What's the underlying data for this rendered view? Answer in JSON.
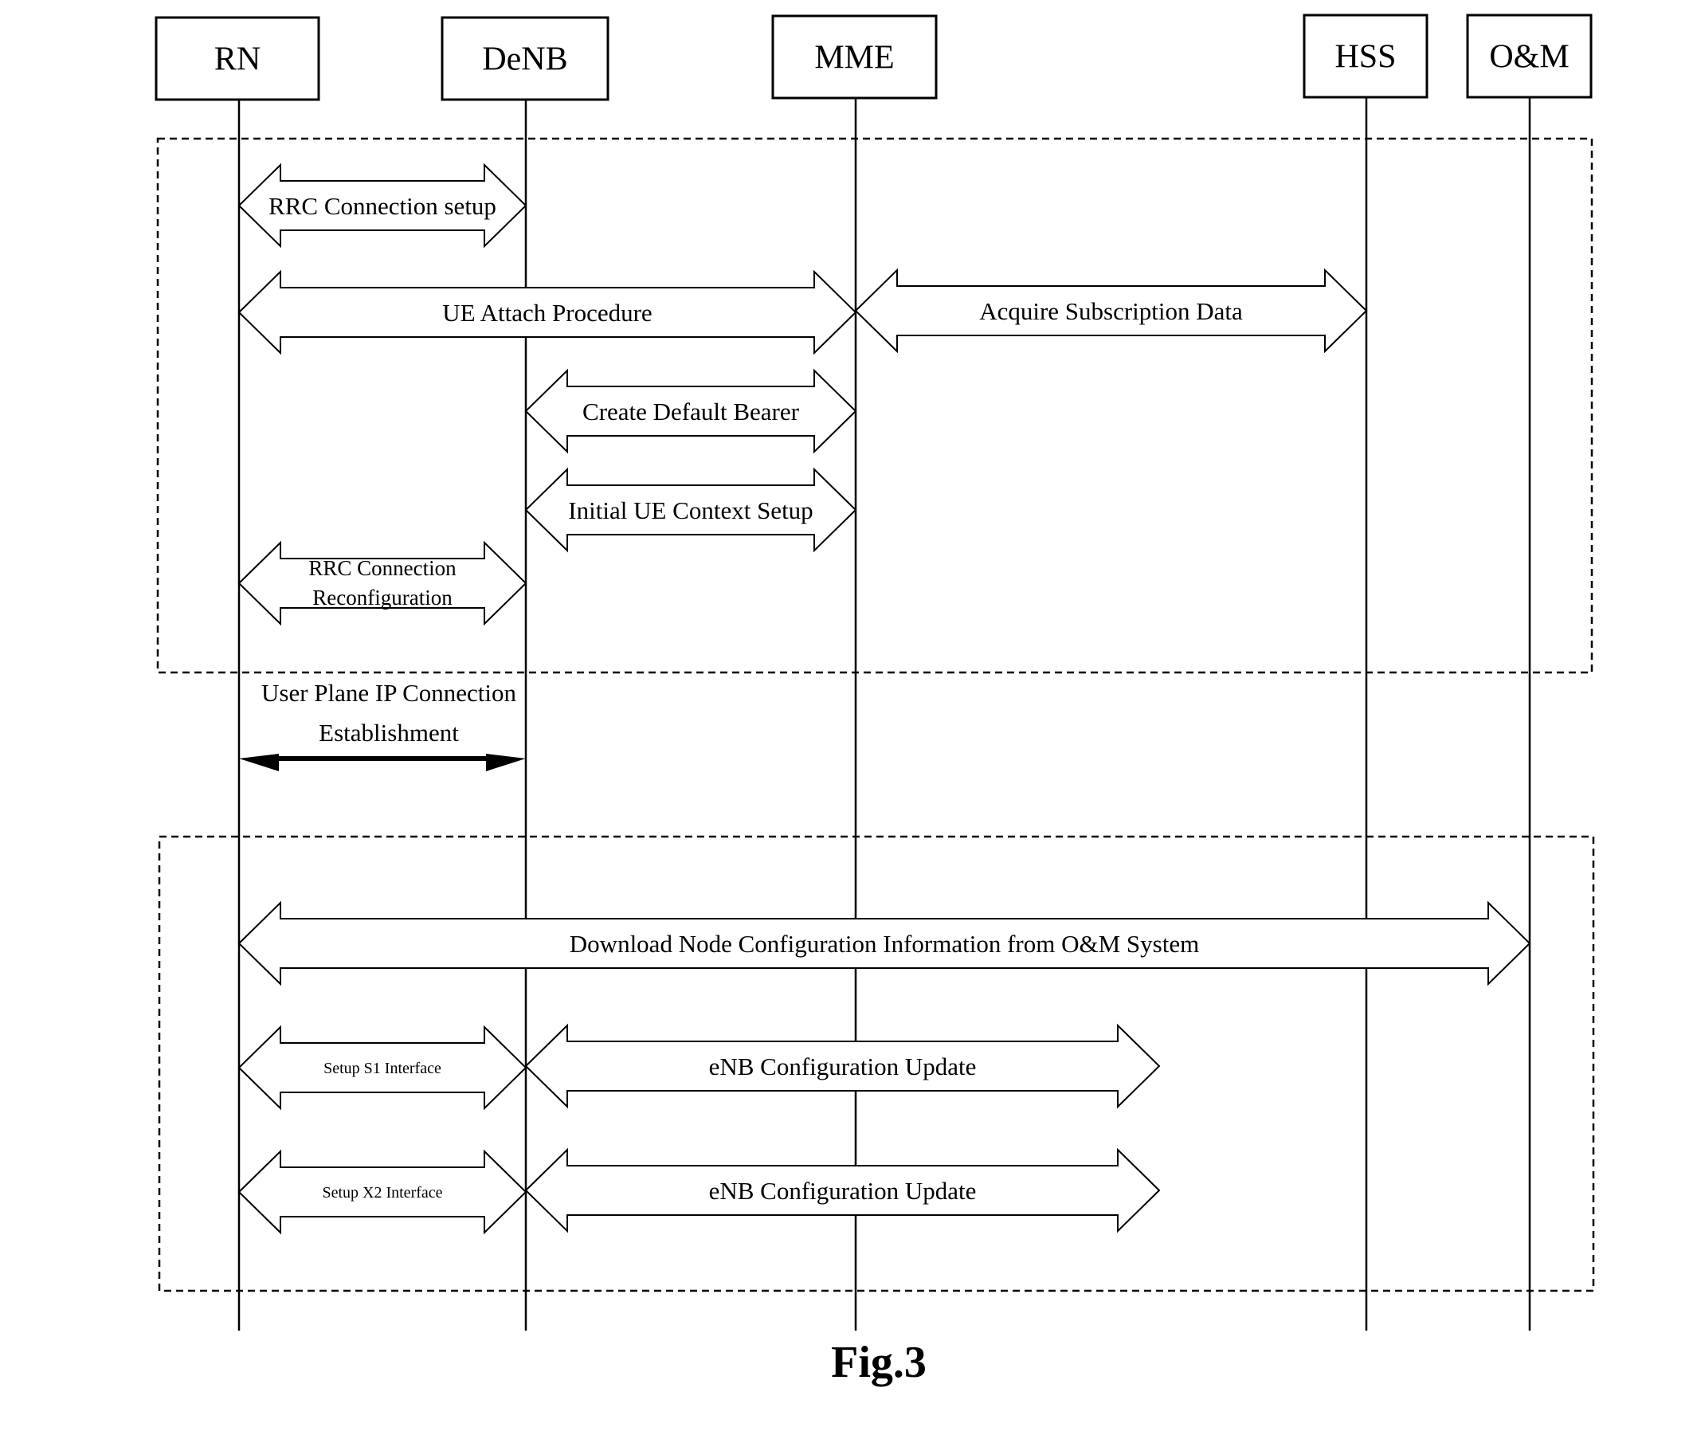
{
  "entities": [
    {
      "id": "rn",
      "label": "RN"
    },
    {
      "id": "denb",
      "label": "DeNB"
    },
    {
      "id": "mme",
      "label": "MME"
    },
    {
      "id": "hss",
      "label": "HSS"
    },
    {
      "id": "om",
      "label": "O&M"
    }
  ],
  "messages": [
    {
      "id": "rrc-setup",
      "from": "rn",
      "to": "denb",
      "lines": [
        "RRC Connection setup"
      ],
      "style": "hollow"
    },
    {
      "id": "ue-attach",
      "from": "rn",
      "to": "mme",
      "lines": [
        "UE Attach Procedure"
      ],
      "style": "hollow"
    },
    {
      "id": "acquire-sub",
      "from": "mme",
      "to": "hss",
      "lines": [
        "Acquire Subscription Data"
      ],
      "style": "hollow"
    },
    {
      "id": "create-bearer",
      "from": "denb",
      "to": "mme",
      "lines": [
        "Create Default Bearer"
      ],
      "style": "hollow"
    },
    {
      "id": "initial-ue",
      "from": "denb",
      "to": "mme",
      "lines": [
        "Initial UE Context Setup"
      ],
      "style": "hollow"
    },
    {
      "id": "rrc-reconf",
      "from": "rn",
      "to": "denb",
      "lines": [
        "RRC Connection",
        "Reconfiguration"
      ],
      "style": "hollow"
    },
    {
      "id": "user-plane",
      "from": "rn",
      "to": "denb",
      "lines": [
        "User Plane IP Connection",
        "Establishment"
      ],
      "style": "solid"
    },
    {
      "id": "download-config",
      "from": "rn",
      "to": "om",
      "lines": [
        "Download Node Configuration Information from O&M System"
      ],
      "style": "hollow"
    },
    {
      "id": "setup-s1",
      "from": "rn",
      "to": "denb",
      "lines": [
        "Setup S1 Interface"
      ],
      "style": "hollow"
    },
    {
      "id": "enb-update-1",
      "from": "denb",
      "to": "mid",
      "lines": [
        "eNB Configuration Update"
      ],
      "style": "hollow"
    },
    {
      "id": "setup-x2",
      "from": "rn",
      "to": "denb",
      "lines": [
        "Setup X2 Interface"
      ],
      "style": "hollow"
    },
    {
      "id": "enb-update-2",
      "from": "denb",
      "to": "mid",
      "lines": [
        "eNB Configuration Update"
      ],
      "style": "hollow"
    }
  ],
  "caption": "Fig.3"
}
